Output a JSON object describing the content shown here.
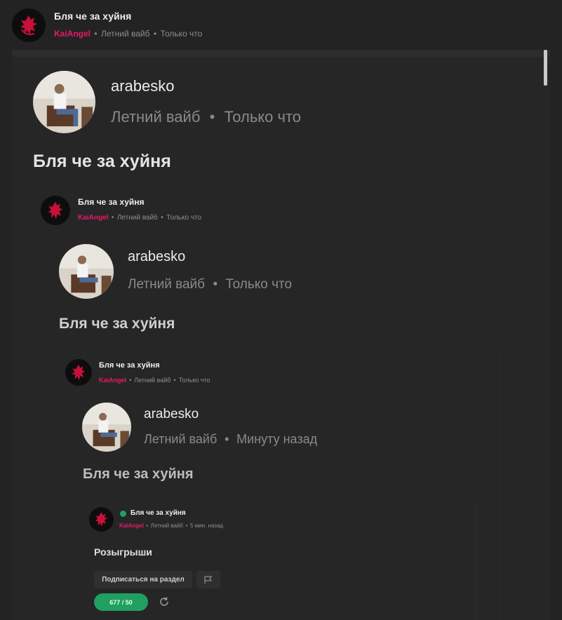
{
  "post": {
    "title": "Бля че за хуйня",
    "author": "KaiAngel",
    "section": "Летний вайб",
    "time": "Только что"
  },
  "level1": {
    "username": "arabesko",
    "section": "Летний вайб",
    "time": "Только что",
    "text": "Бля че за хуйня"
  },
  "level2_header": {
    "title": "Бля че за хуйня",
    "author": "KaiAngel",
    "section": "Летний вайб",
    "time": "Только что"
  },
  "level2": {
    "username": "arabesko",
    "section": "Летний вайб",
    "time": "Только что",
    "text": "Бля че за хуйня"
  },
  "level3_header": {
    "title": "Бля че за хуйня",
    "author": "KaiAngel",
    "section": "Летний вайб",
    "time": "Только что"
  },
  "level3": {
    "username": "arabesko",
    "section": "Летний вайб",
    "time": "Минуту назад",
    "text": "Бля че за хуйня"
  },
  "level4_header": {
    "title": "Бля че за хуйня",
    "author": "KaiAngel",
    "section": "Летний вайб",
    "time": "5 мин. назад"
  },
  "level4": {
    "section_title": "Розыгрыши",
    "subscribe_label": "Подписаться на раздел",
    "counter": "677 / 50"
  },
  "separator": "•",
  "colors": {
    "accent": "#e8196a",
    "green": "#1fa060",
    "background": "#232323"
  },
  "icons": [
    "demon-avatar",
    "person-avatar",
    "flag-icon",
    "refresh-icon",
    "status-dot"
  ]
}
